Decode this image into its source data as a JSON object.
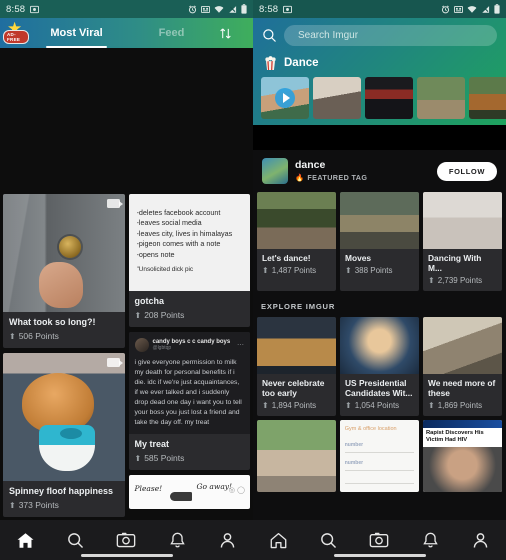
{
  "status_bar": {
    "time": "8:58",
    "icons": [
      "screenshot-icon",
      "alarm-icon",
      "cast-icon",
      "wifi-icon",
      "signal-icon",
      "battery-icon"
    ]
  },
  "left_screen": {
    "app_badge": "AD-FREE",
    "tabs": [
      {
        "label": "Most Viral",
        "active": true
      },
      {
        "label": "Feed",
        "active": false
      }
    ],
    "sort_icon": "sort-arrows-icon",
    "posts": [
      {
        "title": "What took so long?!",
        "points": "506 Points",
        "media": "video"
      },
      {
        "title": "gotcha",
        "points": "208 Points",
        "media": "text-screenshot",
        "text_lines": [
          "-deletes facebook account",
          "-leaves social media",
          "-leaves city, lives in himalayas",
          "-pigeon comes with a note",
          "-opens note"
        ],
        "text_last": "\"Unsolicited dick pic"
      },
      {
        "title": "Spinney floof happiness",
        "points": "373 Points",
        "media": "video"
      },
      {
        "title": "My treat",
        "points": "585 Points",
        "media": "tumblr-screenshot",
        "username": "candy boys c c candy boys",
        "handle": "@lgbtqp",
        "body": "i give everyone permission to milk my death for personal benefits if i die. idc if we're just acquaintances, if we ever talked and i suddenly drop dead one day i want you to tell your boss you just lost a friend and take the day off. my treat"
      },
      {
        "media": "sketch",
        "sketch_left": "Please!",
        "sketch_right": "Go away!"
      }
    ],
    "bottom_nav": [
      {
        "name": "home",
        "icon": "home-icon",
        "active": true
      },
      {
        "name": "search",
        "icon": "search-icon",
        "active": false
      },
      {
        "name": "camera",
        "icon": "camera-icon",
        "active": false
      },
      {
        "name": "notifications",
        "icon": "bell-icon",
        "active": false
      },
      {
        "name": "profile",
        "icon": "person-icon",
        "active": false
      }
    ]
  },
  "right_screen": {
    "search": {
      "placeholder": "Search Imgur",
      "value": "",
      "icon": "search-icon"
    },
    "section": {
      "icon": "popcorn-icon",
      "title": "Dance"
    },
    "carousel": [
      {
        "id": 1,
        "has_play": true
      },
      {
        "id": 2,
        "has_play": false
      },
      {
        "id": 3,
        "has_play": false
      },
      {
        "id": 4,
        "has_play": false
      },
      {
        "id": 5,
        "has_play": false
      },
      {
        "id": 6,
        "has_play": false
      }
    ],
    "tag": {
      "name": "dance",
      "badge_icon": "fire-icon",
      "badge": "FEATURED TAG",
      "follow_label": "FOLLOW"
    },
    "tag_posts": [
      {
        "title": "Let's dance!",
        "points": "1,487 Points"
      },
      {
        "title": "Moves",
        "points": "388 Points"
      },
      {
        "title": "Dancing With M...",
        "points": "2,739 Points"
      }
    ],
    "explore_label": "EXPLORE IMGUR",
    "explore_posts": [
      {
        "title": "Never celebrate too early",
        "points": "1,894 Points"
      },
      {
        "title": "US Presidential Candidates Wit...",
        "points": "1,054 Points"
      },
      {
        "title": "We need more of these",
        "points": "1,869 Points"
      }
    ],
    "explore_row2": [
      {
        "caption": ""
      },
      {
        "form_title": "Gym & office location",
        "form_labels": [
          "number",
          "number"
        ]
      },
      {
        "headline": "Rapist Discovers His Victim Had HIV"
      }
    ],
    "bottom_nav": [
      {
        "name": "home",
        "icon": "home-icon",
        "active": false
      },
      {
        "name": "search",
        "icon": "search-icon",
        "active": false
      },
      {
        "name": "camera",
        "icon": "camera-icon",
        "active": false
      },
      {
        "name": "notifications",
        "icon": "bell-icon",
        "active": false
      },
      {
        "name": "profile",
        "icon": "person-icon",
        "active": false
      }
    ]
  },
  "colors": {
    "header_start": "#1f6f9a",
    "header_mid": "#20857f",
    "header_end": "#1fa35e",
    "card_bg": "#2b2b2e",
    "page_bg": "#0e0e0f",
    "nav_bg": "#1b1b1d",
    "accent_white": "#ffffff"
  }
}
